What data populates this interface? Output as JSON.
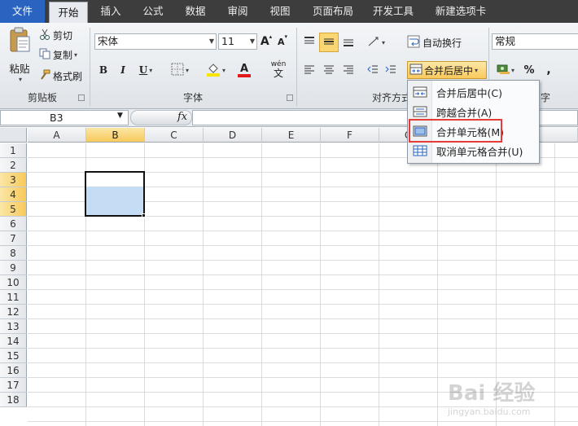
{
  "tabs": [
    "文件",
    "开始",
    "插入",
    "公式",
    "数据",
    "审阅",
    "视图",
    "页面布局",
    "开发工具",
    "新建选项卡"
  ],
  "clipboard": {
    "paste": "粘贴",
    "cut": "剪切",
    "copy": "复制",
    "format_painter": "格式刷",
    "group": "剪贴板"
  },
  "font": {
    "name": "宋体",
    "size": "11",
    "grow": "A",
    "shrink": "A",
    "bold": "B",
    "italic": "I",
    "underline": "U",
    "font_color_letter": "A",
    "phonetic": "wén",
    "group": "字体"
  },
  "alignment": {
    "wrap_text": "自动换行",
    "merge_center": "合并后居中",
    "group": "对齐方式"
  },
  "number": {
    "format": "常规",
    "percent": "%",
    "comma": ",",
    "group_partial": "字"
  },
  "formula_bar": {
    "name_box": "B3",
    "fx": "fx",
    "value": ""
  },
  "sheet": {
    "columns": [
      "A",
      "B",
      "C",
      "D",
      "E",
      "F",
      "G"
    ],
    "selected_column": "B",
    "rows": [
      "1",
      "2",
      "3",
      "4",
      "5",
      "6",
      "7",
      "8",
      "9",
      "10",
      "11",
      "12",
      "13",
      "14",
      "15",
      "16",
      "17",
      "18"
    ],
    "selected_rows": [
      "3",
      "4",
      "5"
    ]
  },
  "merge_menu": {
    "items": [
      {
        "label": "合并后居中(C)",
        "icon": "merge-center-icon"
      },
      {
        "label": "跨越合并(A)",
        "icon": "merge-across-icon"
      },
      {
        "label": "合并单元格(M)",
        "icon": "merge-cells-icon"
      },
      {
        "label": "取消单元格合并(U)",
        "icon": "unmerge-cells-icon"
      }
    ],
    "highlighted": "合并单元格(M)"
  },
  "watermark": {
    "brand": "Bai 经验",
    "url": "jingyan.baidu.com"
  },
  "colors": {
    "file_tab": "#2a64c0",
    "selection_fill": "#c5dcf5",
    "highlight_box": "#e53b3b",
    "header_selected": "#f7c95a"
  }
}
